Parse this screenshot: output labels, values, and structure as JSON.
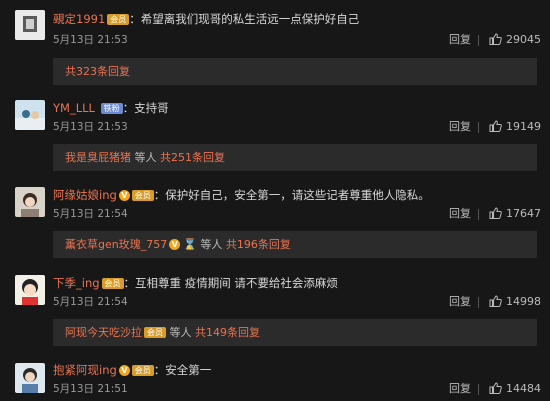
{
  "comments": [
    {
      "username": "覡定1991",
      "badge": "会员",
      "text": "：希望离我们现哥的私生活远一点保护好自己",
      "time": "5月13日 21:53",
      "reply": "回复",
      "likes": "29045",
      "sub_prefix": "",
      "sub_mid": "",
      "sub_count": "共323条回复"
    },
    {
      "username": "YM_LLL",
      "badge": "铁粉",
      "text": "：支持哥",
      "time": "5月13日 21:53",
      "reply": "回复",
      "likes": "19149",
      "sub_prefix": "我是臭屁猪猪",
      "sub_mid": " 等人 ",
      "sub_count": "共251条回复"
    },
    {
      "username": "阿缘姑娘ing",
      "badge": "会员",
      "text": "：保护好自己，安全第一，请这些记者尊重他人隐私。",
      "time": "5月13日 21:54",
      "reply": "回复",
      "likes": "17647",
      "sub_prefix": "薰衣草gen玫瑰_757",
      "sub_mid": " 等人 ",
      "sub_count": "共196条回复"
    },
    {
      "username": "下季_ing",
      "badge": "会员",
      "text": "：互相尊重 疫情期间 请不要给社会添麻烦",
      "time": "5月13日 21:54",
      "reply": "回复",
      "likes": "14998",
      "sub_prefix": "阿现今天吃沙拉",
      "sub_mid": " 等人 ",
      "sub_count": "共149条回复"
    },
    {
      "username": "抱紧阿现ing",
      "badge": "会员",
      "text": "：安全第一",
      "time": "5月13日 21:51",
      "reply": "回复",
      "likes": "14484"
    }
  ]
}
